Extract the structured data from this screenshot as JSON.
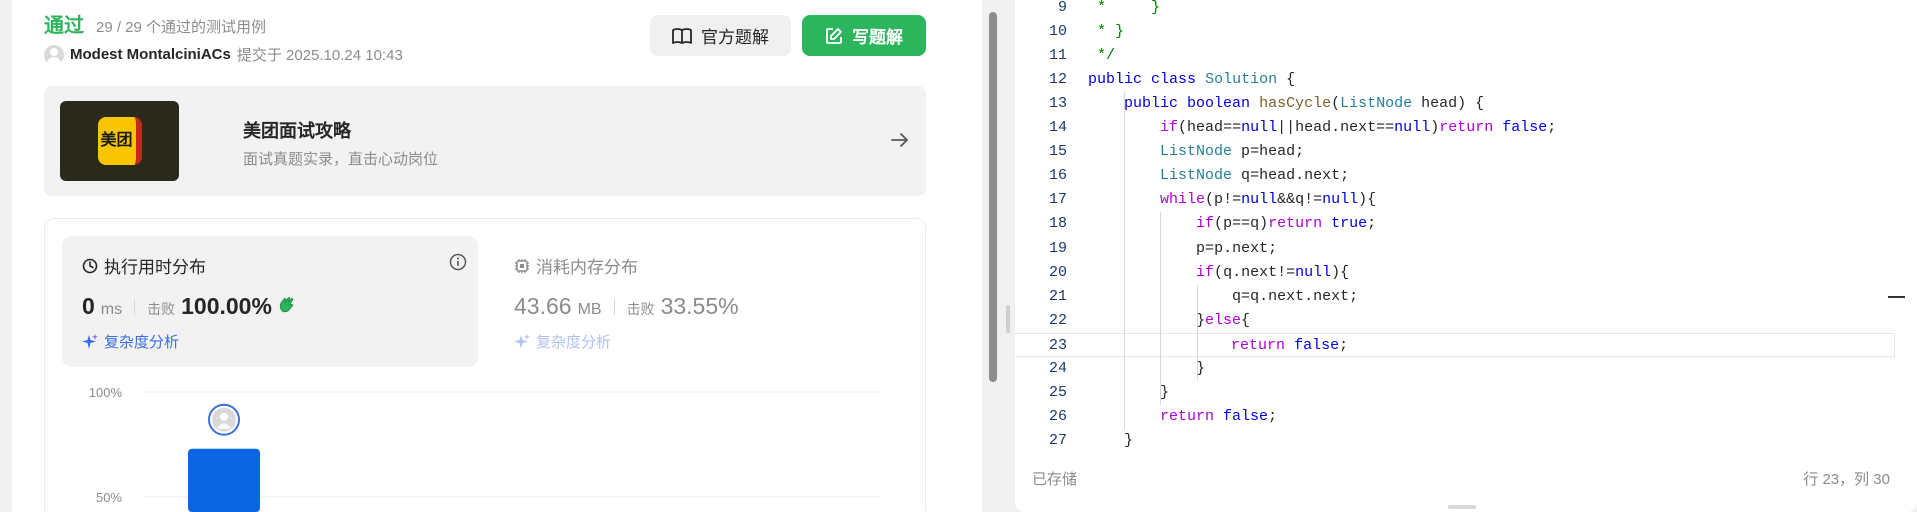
{
  "result": {
    "status": "通过",
    "cases": "29 / 29 个通过的测试用例",
    "author": "Modest MontalciniACs",
    "submitted": "提交于 2025.10.24 10:43"
  },
  "buttons": {
    "official": "官方题解",
    "write": "写题解"
  },
  "ad": {
    "logo_text": "美团",
    "title": "美团面试攻略",
    "subtitle": "面试真题实录，直击心动岗位"
  },
  "runtime": {
    "title": "执行用时分布",
    "value": "0",
    "unit": "ms",
    "beat_label": "击败",
    "beat_value": "100.00%",
    "complexity": "复杂度分析"
  },
  "memory": {
    "title": "消耗内存分布",
    "value": "43.66",
    "unit": "MB",
    "beat_label": "击败",
    "beat_value": "33.55%",
    "complexity": "复杂度分析"
  },
  "chart_data": {
    "type": "bar",
    "y_ticks": [
      "100%",
      "50%"
    ],
    "ylim": [
      0,
      100
    ],
    "values": [
      73
    ],
    "highlight_index": 0
  },
  "code": [
    {
      "n": "9",
      "t": " *     }"
    },
    {
      "n": "10",
      "t": " * }"
    },
    {
      "n": "11",
      "t": " */"
    },
    {
      "n": "12",
      "t": "public class Solution {"
    },
    {
      "n": "13",
      "t": "    public boolean hasCycle(ListNode head) {"
    },
    {
      "n": "14",
      "t": "        if(head==null||head.next==null)return false;"
    },
    {
      "n": "15",
      "t": "        ListNode p=head;"
    },
    {
      "n": "16",
      "t": "        ListNode q=head.next;"
    },
    {
      "n": "17",
      "t": "        while(p!=null&&q!=null){"
    },
    {
      "n": "18",
      "t": "            if(p==q)return true;"
    },
    {
      "n": "19",
      "t": "            p=p.next;"
    },
    {
      "n": "20",
      "t": "            if(q.next!=null){"
    },
    {
      "n": "21",
      "t": "                q=q.next.next;"
    },
    {
      "n": "22",
      "t": "            }else{"
    },
    {
      "n": "23",
      "t": "                return false;"
    },
    {
      "n": "24",
      "t": "            }"
    },
    {
      "n": "25",
      "t": "        }"
    },
    {
      "n": "26",
      "t": "        return false;"
    },
    {
      "n": "27",
      "t": "    }"
    }
  ],
  "editor_footer": {
    "saved": "已存储",
    "position": "行 23，列 30"
  },
  "colors": {
    "accent_green": "#2db55d",
    "bar_blue": "#0a66e0",
    "link_blue": "#3d6fe0"
  }
}
